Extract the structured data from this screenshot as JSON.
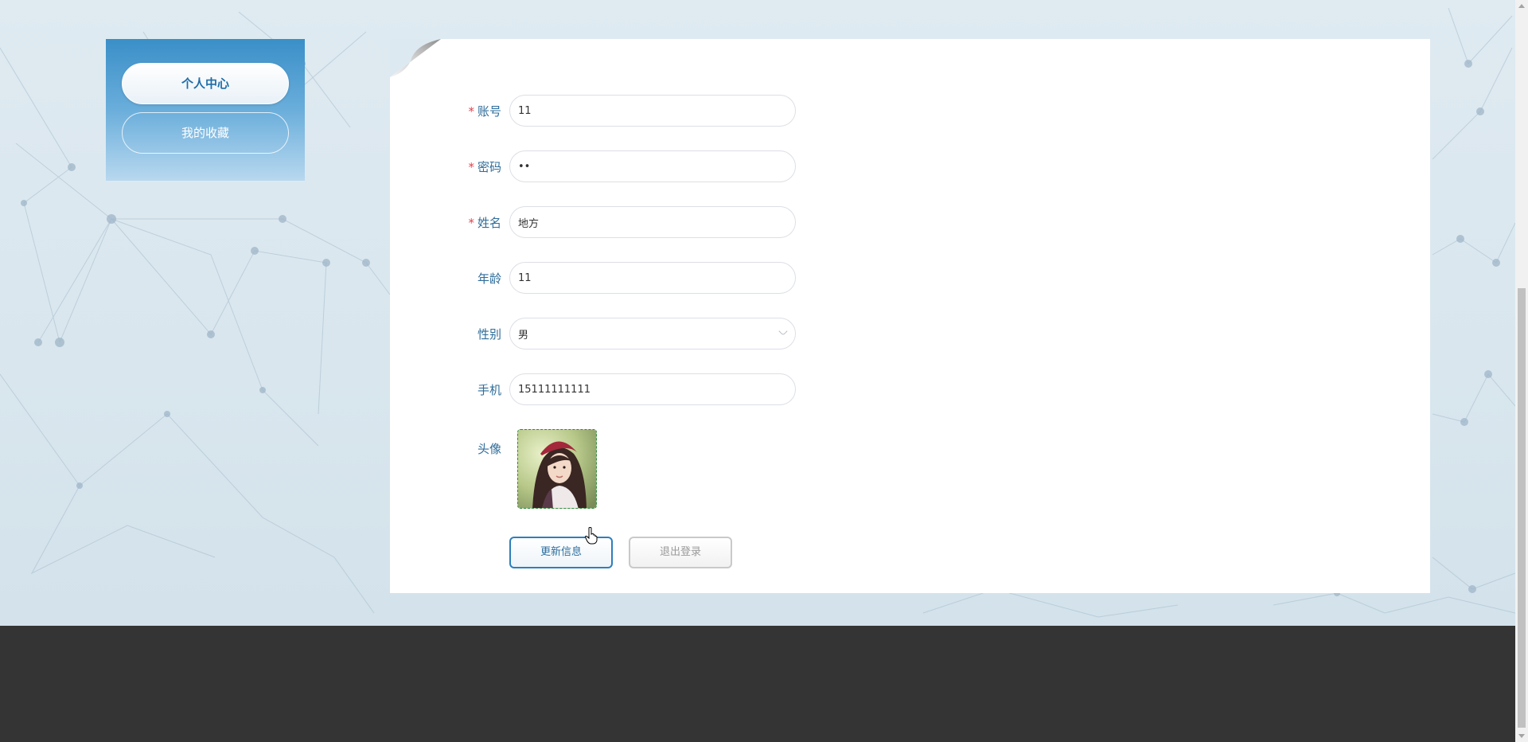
{
  "sidebar": {
    "items": [
      {
        "label": "个人中心",
        "active": true
      },
      {
        "label": "我的收藏",
        "active": false
      }
    ]
  },
  "form": {
    "account": {
      "label": "账号",
      "value": "11",
      "required": true
    },
    "password": {
      "label": "密码",
      "value": "11",
      "required": true
    },
    "name": {
      "label": "姓名",
      "value": "地方",
      "required": true
    },
    "age": {
      "label": "年龄",
      "value": "11",
      "required": false
    },
    "gender": {
      "label": "性别",
      "value": "男",
      "required": false
    },
    "phone": {
      "label": "手机",
      "value": "15111111111",
      "required": false
    },
    "avatar": {
      "label": "头像"
    }
  },
  "buttons": {
    "update": "更新信息",
    "logout": "退出登录"
  },
  "colors": {
    "accent": "#2d7fbd",
    "required": "#e2444e",
    "label": "#2f6d9a",
    "footer": "#343434"
  }
}
